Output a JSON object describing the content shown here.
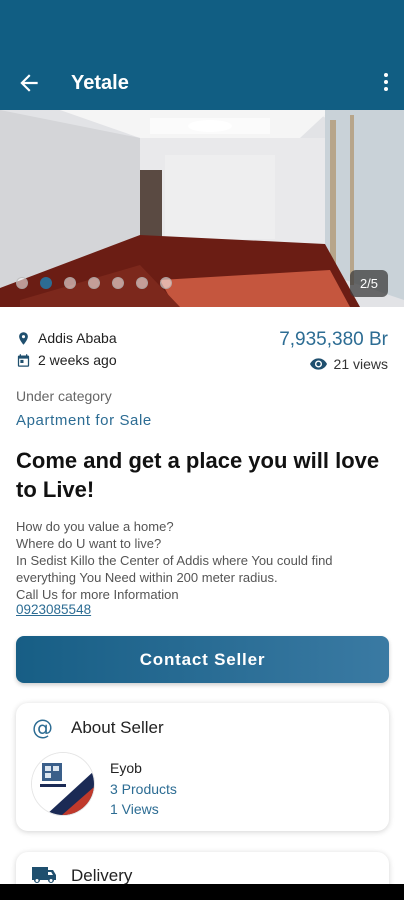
{
  "header": {
    "title": "Yetale"
  },
  "gallery": {
    "counter": "2/5",
    "dot_count": 7,
    "active_index": 1
  },
  "listing": {
    "location": "Addis Ababa",
    "posted": "2 weeks ago",
    "price": "7,935,380 Br",
    "views": "21 views",
    "category_label": "Under category",
    "category": "Apartment for Sale",
    "headline": "Come and get a place you will love to Live!",
    "description": [
      "How do you value a home?",
      "Where do U want to live?",
      "In  Sedist Killo the Center of Addis where You could find",
      "everything You Need within 200 meter radius.",
      "Call Us for more Information"
    ],
    "phone": "0923085548"
  },
  "actions": {
    "contact_label": "Contact Seller"
  },
  "seller": {
    "section_title": "About Seller",
    "name": "Eyob",
    "products": "3 Products",
    "views": "1 Views"
  },
  "delivery": {
    "section_title": "Delivery"
  },
  "colors": {
    "app_bar": "#115e83",
    "accent": "#2c6c93"
  }
}
